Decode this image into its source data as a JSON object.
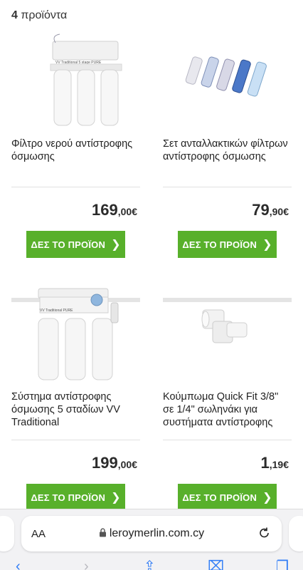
{
  "header": {
    "count_number": "4",
    "count_label": "προϊόντα"
  },
  "products": [
    {
      "title": "Φίλτρο νερού αντίστροφης όσμωσης",
      "price_int": "169",
      "price_dec": ",00€",
      "button": "ΔΕΣ ΤΟ ΠΡΟΪΟΝ",
      "image": "ro-filter-unit-image",
      "img_label": "VV Traditional 5 stage PURE"
    },
    {
      "title": "Σετ ανταλλακτικών φίλτρων αντίστροφης όσμωσης",
      "price_int": "79",
      "price_dec": ",90€",
      "button": "ΔΕΣ ΤΟ ΠΡΟΪΟΝ",
      "image": "filter-cartridges-set-image"
    },
    {
      "title": "Σύστημα αντίστροφης όσμωσης 5 σταδίων VV Traditional",
      "price_int": "199",
      "price_dec": ",00€",
      "button": "ΔΕΣ ΤΟ ΠΡΟΪΟΝ",
      "image": "ro-system-image",
      "img_label": "VV Traditional PURE"
    },
    {
      "title": "Κούμπωμα Quick Fit 3/8\" σε 1/4\" σωληνάκι για συστήματα αντίστροφης",
      "price_int": "1",
      "price_dec": ",19€",
      "button": "ΔΕΣ ΤΟ ΠΡΟΪΟΝ",
      "image": "quick-fit-connector-image"
    }
  ],
  "browser": {
    "aa": "AA",
    "url": "leroymerlin.com.cy"
  },
  "colors": {
    "accent": "#58b02b",
    "link": "#2f7cf6"
  }
}
